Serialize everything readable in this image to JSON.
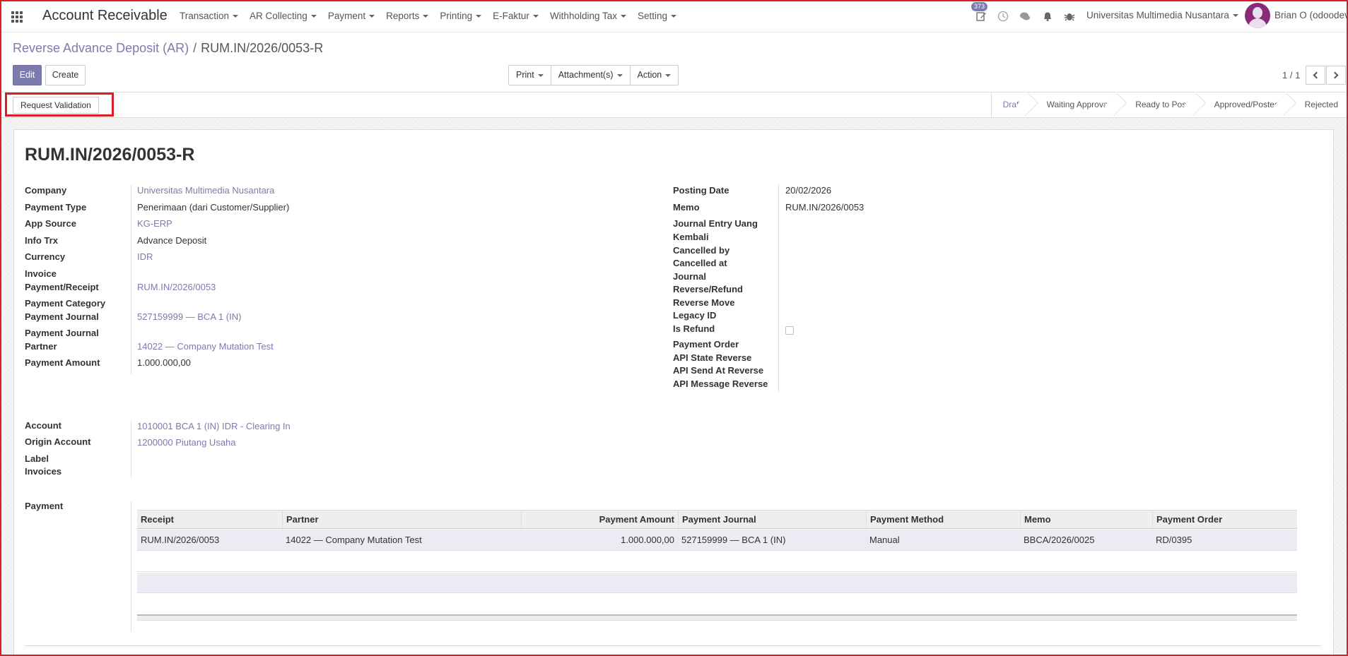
{
  "navbar": {
    "app_title": "Account Receivable",
    "menu": [
      "Transaction",
      "AR Collecting",
      "Payment",
      "Reports",
      "Printing",
      "E-Faktur",
      "Withholding Tax",
      "Setting"
    ],
    "activity_count": "373",
    "company": "Universitas Multimedia Nusantara",
    "user": "Brian O (odoodeve"
  },
  "control": {
    "breadcrumb_parent": "Reverse Advance Deposit (AR)",
    "breadcrumb_sep": "/",
    "breadcrumb_current": "RUM.IN/2026/0053-R",
    "edit_label": "Edit",
    "create_label": "Create",
    "print_label": "Print",
    "attachments_label": "Attachment(s)",
    "action_label": "Action",
    "pager": "1 / 1"
  },
  "statusbar": {
    "request_validation_label": "Request Validation",
    "stages": [
      "Draft",
      "Waiting Approval",
      "Ready to Post",
      "Approved/Posted",
      "Rejected"
    ],
    "active_stage": "Draft"
  },
  "record": {
    "title": "RUM.IN/2026/0053-R",
    "left": {
      "company_label": "Company",
      "company": "Universitas Multimedia Nusantara",
      "payment_type_label": "Payment Type",
      "payment_type": "Penerimaan (dari Customer/Supplier)",
      "app_source_label": "App Source",
      "app_source": "KG-ERP",
      "info_trx_label": "Info Trx",
      "info_trx": "Advance Deposit",
      "currency_label": "Currency",
      "currency": "IDR",
      "invoice_receipt_label_1": "Invoice",
      "invoice_receipt_label_2": "Payment/Receipt",
      "invoice_receipt": "RUM.IN/2026/0053",
      "payment_category_label": "Payment Category",
      "payment_journal_label": "Payment Journal",
      "payment_journal": "527159999 — BCA 1 (IN)",
      "payment_journal2_label": "Payment Journal",
      "partner_label": "Partner",
      "partner": "14022 — Company Mutation Test",
      "payment_amount_label": "Payment Amount",
      "payment_amount": "1.000.000,00"
    },
    "right": {
      "posting_date_label": "Posting Date",
      "posting_date": "20/02/2026",
      "memo_label": "Memo",
      "memo": "RUM.IN/2026/0053",
      "journal_entry_label_1": "Journal Entry Uang",
      "journal_entry_label_2": "Kembali",
      "cancelled_by_label": "Cancelled by",
      "cancelled_at_label": "Cancelled at",
      "journal_label": "Journal",
      "reverse_refund_label": "Reverse/Refund",
      "reverse_move_label": "Reverse Move",
      "legacy_id_label": "Legacy ID",
      "is_refund_label": "Is Refund",
      "payment_order_label": "Payment Order",
      "api_state_reverse_label": "API State Reverse",
      "api_send_at_reverse_label": "API Send At Reverse",
      "api_message_reverse_label": "API Message Reverse"
    },
    "accounts": {
      "account_label": "Account",
      "account": "1010001 BCA 1 (IN) IDR - Clearing In",
      "origin_account_label": "Origin Account",
      "origin_account": "1200000 Piutang Usaha",
      "label_label": "Label",
      "invoices_label": "Invoices"
    },
    "payment_section_label": "Payment"
  },
  "payment_table": {
    "columns": [
      "Receipt",
      "Partner",
      "Payment Amount",
      "Payment Journal",
      "Payment Method",
      "Memo",
      "Payment Order"
    ],
    "rows": [
      [
        "RUM.IN/2026/0053",
        "14022 — Company Mutation Test",
        "1.000.000,00",
        "527159999 — BCA 1 (IN)",
        "Manual",
        "BBCA/2026/0025",
        "RD/0395"
      ]
    ]
  },
  "colors": {
    "accent": "#7c7bad",
    "highlight_border": "#d91f26"
  }
}
